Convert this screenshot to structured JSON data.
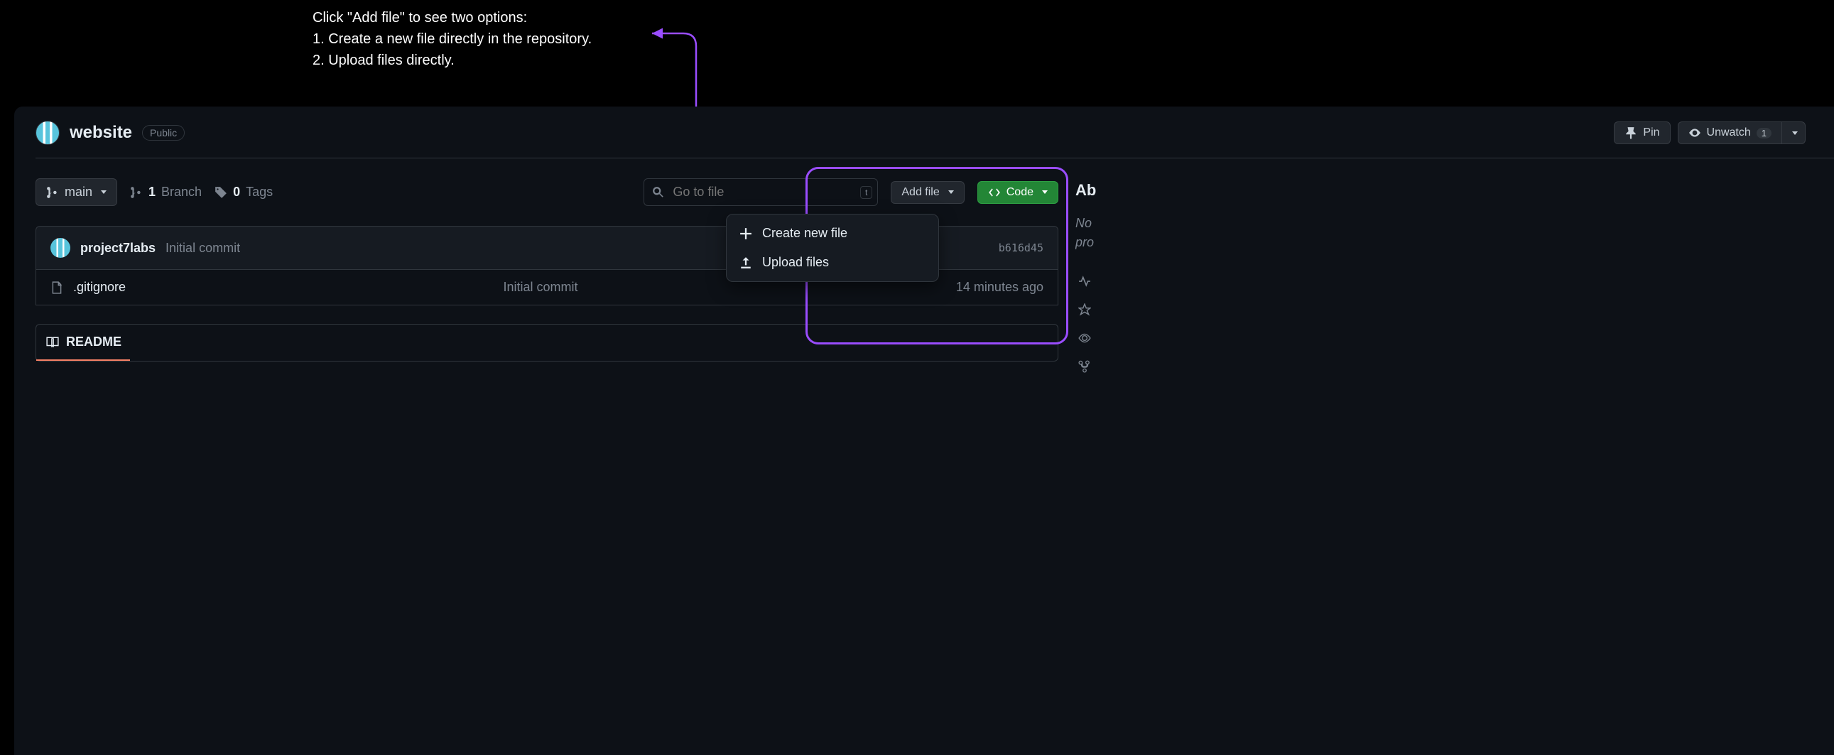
{
  "annotation": {
    "line1": "Click \"Add file\" to see two options:",
    "line2": "1. Create a new file directly in the repository.",
    "line3": "2. Upload files directly."
  },
  "repo": {
    "name": "website",
    "visibility": "Public"
  },
  "header_actions": {
    "pin": "Pin",
    "unwatch": "Unwatch",
    "unwatch_count": "1"
  },
  "toolbar": {
    "branch": "main",
    "branch_count": "1",
    "branch_label": "Branch",
    "tag_count": "0",
    "tag_label": "Tags",
    "search_placeholder": "Go to file",
    "search_kbd": "t",
    "add_file": "Add file",
    "code": "Code"
  },
  "dropdown": {
    "create": "Create new file",
    "upload": "Upload files"
  },
  "commit": {
    "author": "project7labs",
    "message": "Initial commit",
    "sha": "b616d45"
  },
  "files": [
    {
      "name": ".gitignore",
      "message": "Initial commit",
      "time": "14 minutes ago"
    }
  ],
  "readme": {
    "label": "README"
  },
  "sidebar": {
    "title": "Ab",
    "desc1": "No",
    "desc2": "pro"
  }
}
